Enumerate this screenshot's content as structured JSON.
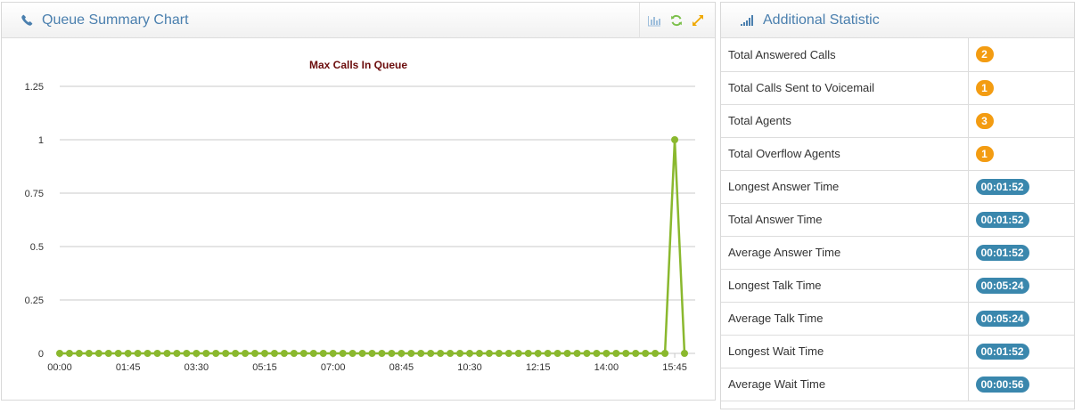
{
  "chart_panel": {
    "title": "Queue Summary Chart",
    "icons": [
      "phone-icon",
      "bar-chart-icon",
      "refresh-icon",
      "expand-icon"
    ]
  },
  "stats_panel": {
    "title": "Additional Statistic",
    "icon": "signal-bars-icon",
    "rows": [
      {
        "label": "Total Answered Calls",
        "value": "2",
        "kind": "count"
      },
      {
        "label": "Total Calls Sent to Voicemail",
        "value": "1",
        "kind": "count"
      },
      {
        "label": "Total Agents",
        "value": "3",
        "kind": "count"
      },
      {
        "label": "Total Overflow Agents",
        "value": "1",
        "kind": "count"
      },
      {
        "label": "Longest Answer Time",
        "value": "00:01:52",
        "kind": "time"
      },
      {
        "label": "Total Answer Time",
        "value": "00:01:52",
        "kind": "time"
      },
      {
        "label": "Average Answer Time",
        "value": "00:01:52",
        "kind": "time"
      },
      {
        "label": "Longest Talk Time",
        "value": "00:05:24",
        "kind": "time"
      },
      {
        "label": "Average Talk Time",
        "value": "00:05:24",
        "kind": "time"
      },
      {
        "label": "Longest Wait Time",
        "value": "00:01:52",
        "kind": "time"
      },
      {
        "label": "Average Wait Time",
        "value": "00:00:56",
        "kind": "time"
      }
    ],
    "colors": {
      "count_badge": "#f39c12",
      "time_badge": "#3a87ad"
    }
  },
  "chart_data": {
    "type": "line",
    "title": "Max Calls In Queue",
    "xlabel": "",
    "ylabel": "",
    "ylim": [
      0,
      1.25
    ],
    "y_ticks": [
      "0",
      "0.25",
      "0.5",
      "0.75",
      "1",
      "1.25"
    ],
    "x_tick_labels": [
      "00:00",
      "01:45",
      "03:30",
      "05:15",
      "07:00",
      "08:45",
      "10:30",
      "12:15",
      "14:00",
      "15:45"
    ],
    "x_interval_minutes": 15,
    "x_start": "00:00",
    "x_end": "16:15",
    "grid": true,
    "color": "#8ab82e",
    "series": [
      {
        "values": [
          0,
          0,
          0,
          0,
          0,
          0,
          0,
          0,
          0,
          0,
          0,
          0,
          0,
          0,
          0,
          0,
          0,
          0,
          0,
          0,
          0,
          0,
          0,
          0,
          0,
          0,
          0,
          0,
          0,
          0,
          0,
          0,
          0,
          0,
          0,
          0,
          0,
          0,
          0,
          0,
          0,
          0,
          0,
          0,
          0,
          0,
          0,
          0,
          0,
          0,
          0,
          0,
          0,
          0,
          0,
          0,
          0,
          0,
          0,
          0,
          0,
          0,
          0,
          1,
          0
        ]
      }
    ]
  }
}
